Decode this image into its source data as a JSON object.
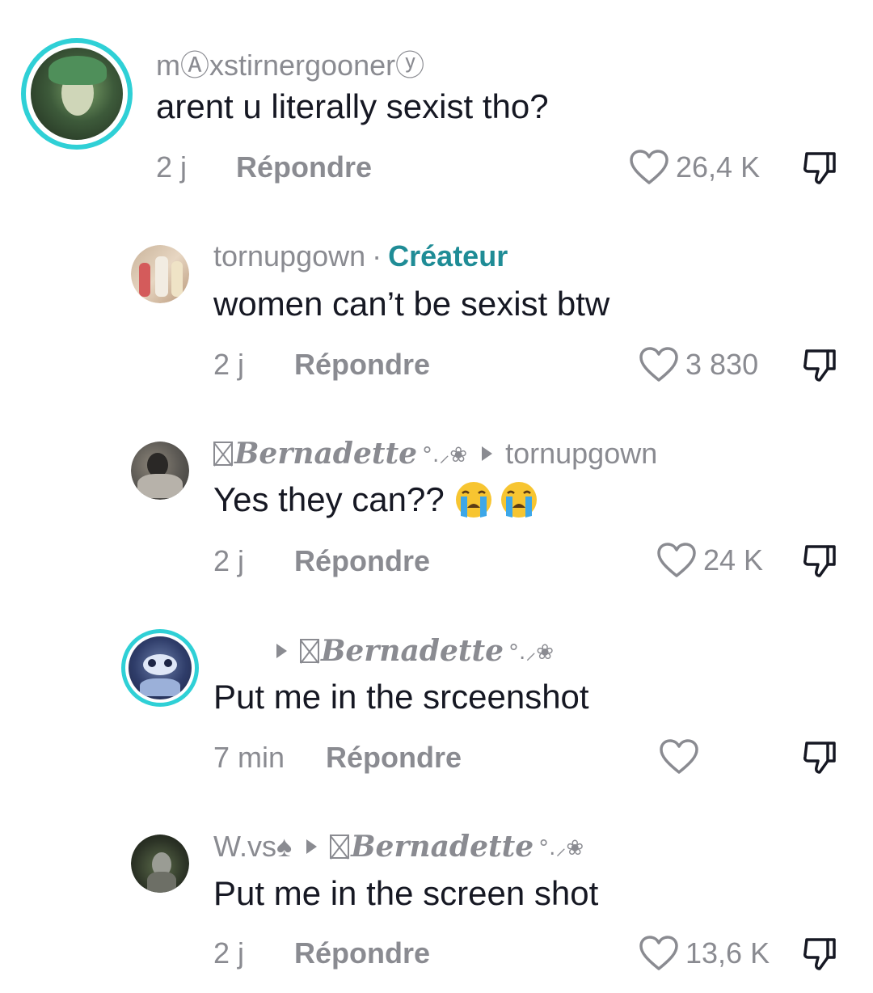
{
  "comments": [
    {
      "username": "mⒶxstirnergoonerⓨ",
      "text": "arent u literally sexist tho?",
      "time": "2 j",
      "reply_label": "Répondre",
      "likes": "26,4 K"
    },
    {
      "username": "tornupgown",
      "creator_sep": "·",
      "creator_label": "Créateur",
      "text": "women can’t be sexist btw",
      "time": "2 j",
      "reply_label": "Répondre",
      "likes": "3 830"
    },
    {
      "username": "Bernadette",
      "username_deco": "°.⸝❀",
      "reply_to": "tornupgown",
      "text": "Yes they can??",
      "time": "2 j",
      "reply_label": "Répondre",
      "likes": "24 K"
    },
    {
      "reply_to": "Bernadette",
      "reply_to_deco": "°.⸝❀",
      "text": "Put me in the srceenshot",
      "time": "7 min",
      "reply_label": "Répondre",
      "likes": ""
    },
    {
      "username": "W.vs♠",
      "reply_to": "Bernadette",
      "reply_to_deco": "°.⸝❀",
      "text": "Put me in the screen shot",
      "time": "2 j",
      "reply_label": "Répondre",
      "likes": "13,6 K"
    }
  ],
  "colors": {
    "story_ring": "#2fd0d6",
    "creator": "#1f8c96",
    "secondary_text": "#8a8b91"
  },
  "icons": [
    "heart-outline-icon",
    "thumbs-down-icon",
    "crying-face-emoji"
  ]
}
